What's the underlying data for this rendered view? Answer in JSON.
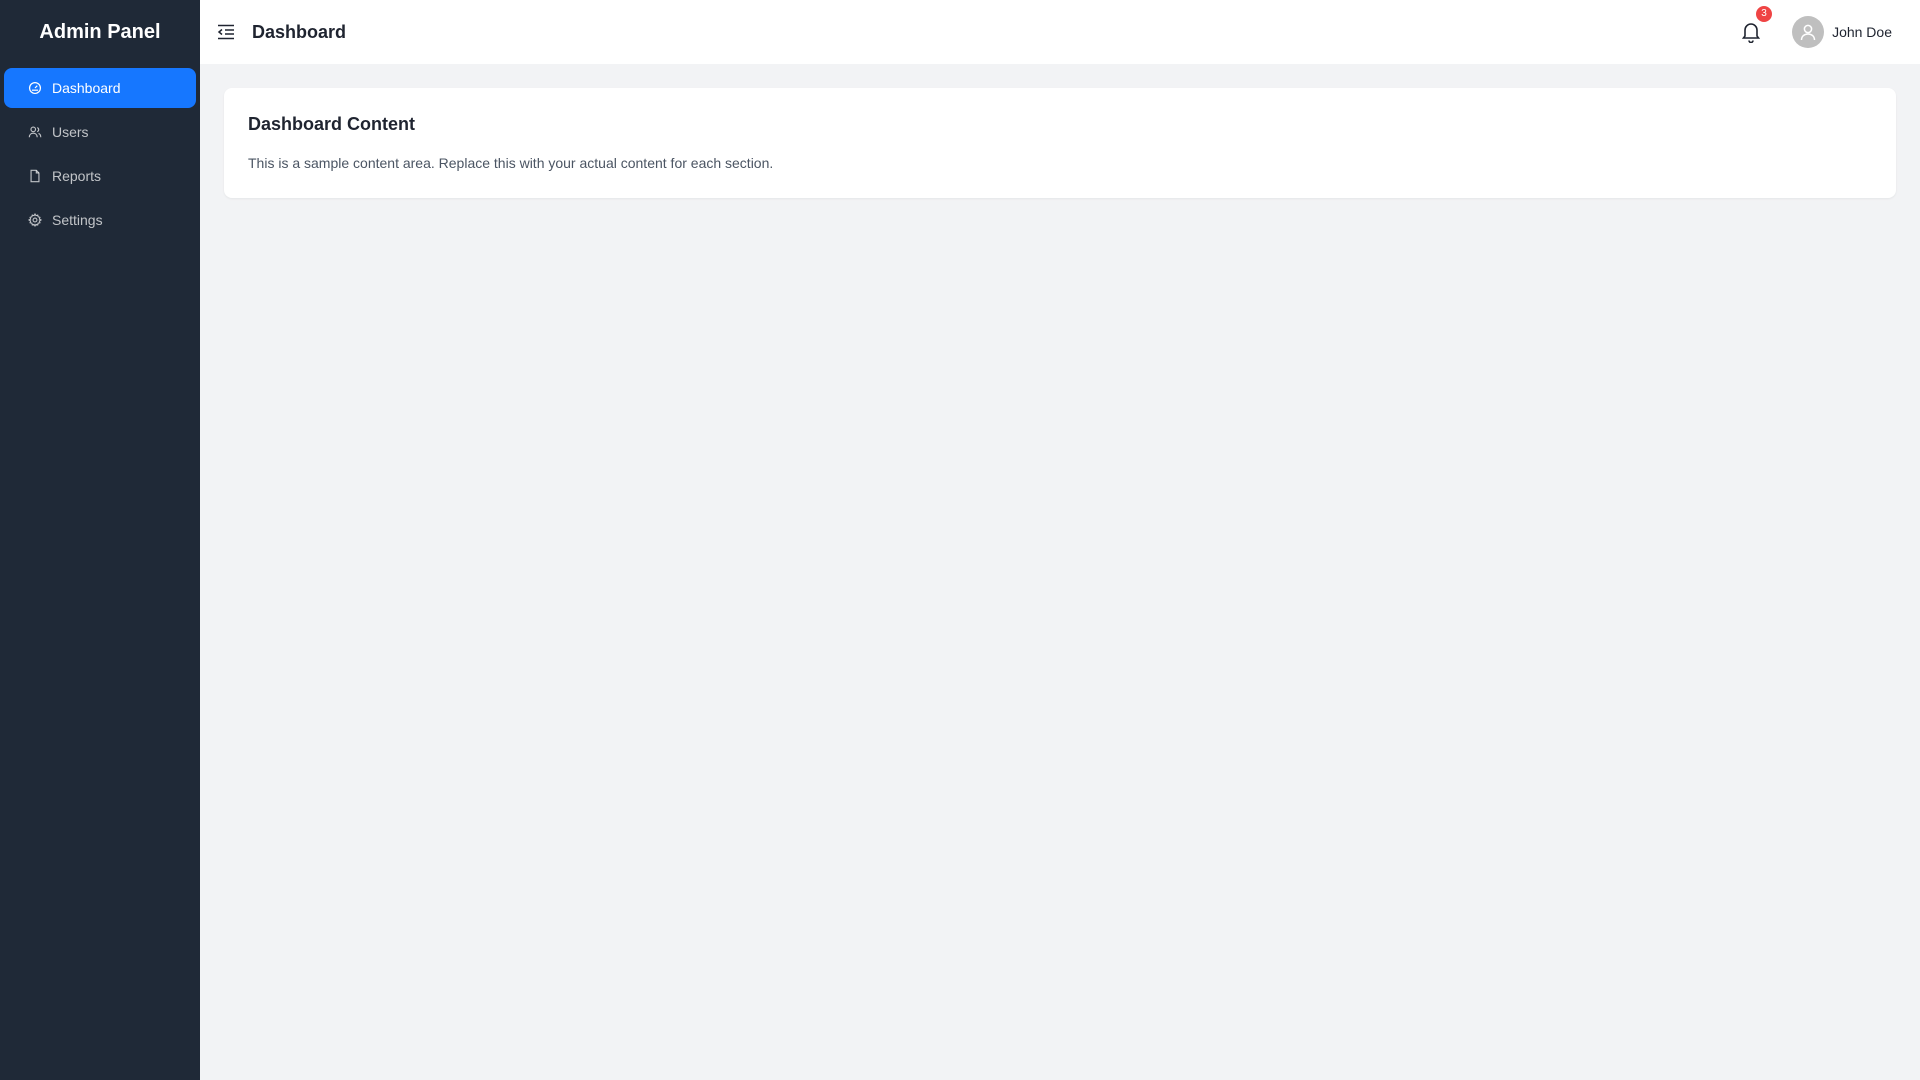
{
  "sidebar": {
    "brand": "Admin Panel",
    "items": [
      {
        "label": "Dashboard",
        "icon": "dashboard-icon",
        "active": true
      },
      {
        "label": "Users",
        "icon": "users-icon",
        "active": false
      },
      {
        "label": "Reports",
        "icon": "file-icon",
        "active": false
      },
      {
        "label": "Settings",
        "icon": "gear-icon",
        "active": false
      }
    ]
  },
  "header": {
    "title": "Dashboard",
    "notifications_count": "3",
    "user_name": "John Doe"
  },
  "main": {
    "card_title": "Dashboard Content",
    "card_text": "This is a sample content area. Replace this with your actual content for each section."
  },
  "colors": {
    "sidebar_bg": "#1f2937",
    "accent": "#1677ff",
    "badge": "#ef4444",
    "page_bg": "#f2f3f5"
  }
}
